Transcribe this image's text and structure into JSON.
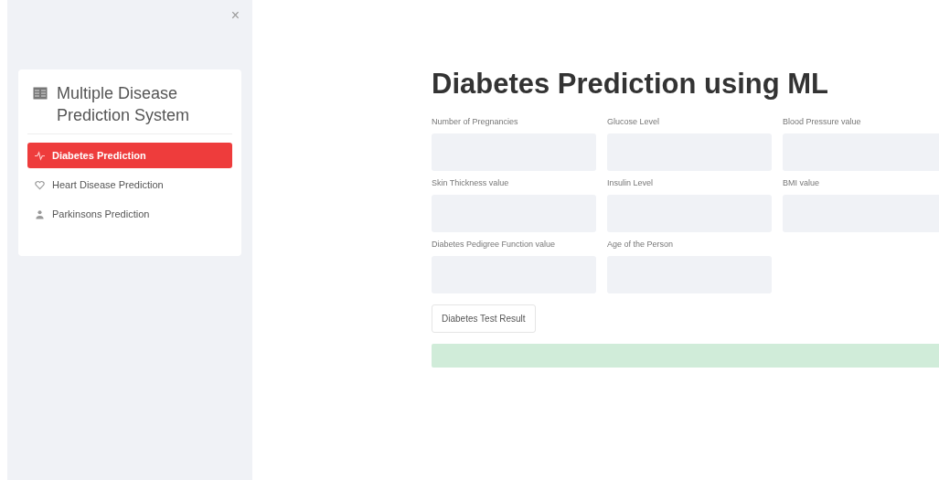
{
  "sidebar": {
    "close": "×",
    "menu": {
      "title": "Multiple Disease Prediction System",
      "items": [
        {
          "label": "Diabetes Prediction",
          "kind": "activity",
          "selected": true
        },
        {
          "label": "Heart Disease Prediction",
          "kind": "heart",
          "selected": false
        },
        {
          "label": "Parkinsons Prediction",
          "kind": "person",
          "selected": false
        }
      ]
    }
  },
  "main": {
    "title": "Diabetes Prediction using ML",
    "fields": [
      {
        "label": "Number of Pregnancies"
      },
      {
        "label": "Glucose Level"
      },
      {
        "label": "Blood Pressure value"
      },
      {
        "label": "Skin Thickness value"
      },
      {
        "label": "Insulin Level"
      },
      {
        "label": "BMI value"
      },
      {
        "label": "Diabetes Pedigree Function value"
      },
      {
        "label": "Age of the Person"
      }
    ],
    "button": "Diabetes Test Result",
    "result": {
      "kind": "success"
    }
  }
}
